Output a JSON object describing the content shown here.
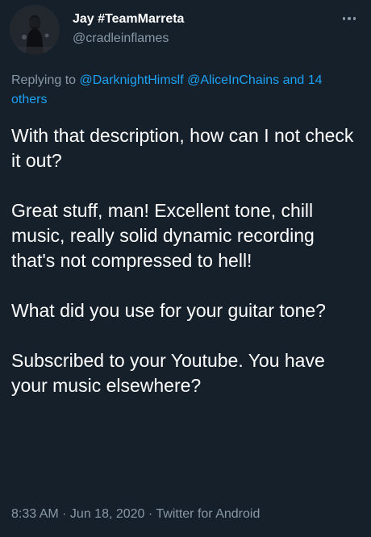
{
  "author": {
    "display_name": "Jay #TeamMarreta",
    "handle": "@cradleinflames"
  },
  "header": {
    "more_icon": "more-horizontal-icon"
  },
  "reply": {
    "prefix": "Replying to ",
    "mention_1": "@DarknightHimslf",
    "mention_2": "@AliceInChains",
    "joiner": " and",
    "others": "14 others"
  },
  "tweet": {
    "paragraphs": [
      "With that description, how can I not check it out?",
      "Great stuff, man! Excellent tone, chill music, really solid dynamic recording that's not compressed to hell!",
      "What did you use for your guitar tone?",
      "Subscribed to your Youtube. You have your music elsewhere?"
    ]
  },
  "meta": {
    "time": "8:33 AM",
    "sep_1": " · ",
    "date": "Jun 18, 2020",
    "sep_2": " · ",
    "source": "Twitter for Android"
  },
  "colors": {
    "background": "#15202b",
    "text": "#ffffff",
    "secondary": "#8899a6",
    "link": "#1da1f2"
  }
}
